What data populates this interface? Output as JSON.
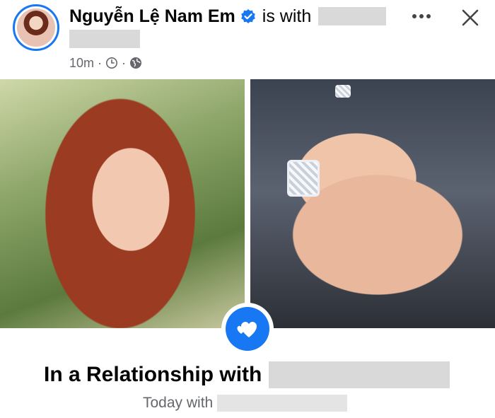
{
  "post": {
    "author": "Nguyễn Lệ Nam Em",
    "with_text": "is with",
    "time": "10m",
    "separator": "·"
  },
  "icons": {
    "verified": "verified-badge-icon",
    "clock": "clock-icon",
    "globe": "globe-icon",
    "more": "more-dots-icon",
    "close": "close-icon",
    "hearts": "hearts-icon"
  },
  "life_event": {
    "title": "In a Relationship with",
    "subtitle": "Today with"
  },
  "colors": {
    "accent": "#1877f2",
    "secondary_text": "#65676b",
    "redaction": "#d9d9d9"
  }
}
